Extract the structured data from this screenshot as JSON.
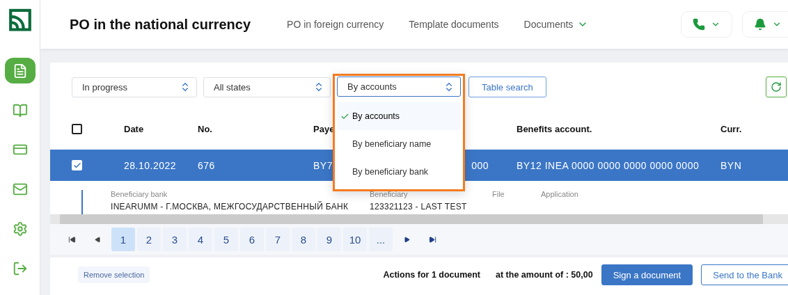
{
  "header": {
    "title": "PO in the national currency",
    "nav": [
      {
        "label": "PO in foreign currency",
        "dropdown": false
      },
      {
        "label": "Template documents",
        "dropdown": false
      },
      {
        "label": "Documents",
        "dropdown": true
      }
    ]
  },
  "sidebar": {
    "items": [
      {
        "selected": true
      },
      {
        "selected": false
      },
      {
        "selected": false
      },
      {
        "selected": false
      },
      {
        "selected": false
      },
      {
        "selected": false
      }
    ]
  },
  "filters": [
    {
      "value": "In progress"
    },
    {
      "value": "All states"
    }
  ],
  "grouping": {
    "value": "By accounts",
    "options": [
      {
        "label": "By accounts",
        "selected": true
      },
      {
        "label": "By beneficiary name",
        "selected": false
      },
      {
        "label": "By beneficiary bank",
        "selected": false
      }
    ]
  },
  "table_search": "Table search",
  "table": {
    "columns": [
      "Date",
      "No.",
      "Paye",
      "Benefits account.",
      "Curr."
    ],
    "select_all": false,
    "rows": [
      {
        "selected": true,
        "date": "28.10.2022",
        "number": "676",
        "payer_start": "BY7",
        "payer_end": "000",
        "benefits_account": "BY12 INEA 0000 0000 0000 0000 0000",
        "currency": "BYN"
      }
    ],
    "details": [
      {
        "label": "Beneficiary bank",
        "value": "INEARUMM - Г.МОСКВА, МЕЖГОСУДАРСТВЕННЫЙ БАНК"
      },
      {
        "label": "Beneficiary",
        "value": "123321123 - LAST TEST"
      },
      {
        "label": "File"
      },
      {
        "label": "Application"
      }
    ]
  },
  "pagination": {
    "pages": [
      {
        "label": "1",
        "selected": true
      },
      {
        "label": "2",
        "selected": false
      },
      {
        "label": "3",
        "selected": false
      },
      {
        "label": "4",
        "selected": false
      },
      {
        "label": "5",
        "selected": false
      },
      {
        "label": "6",
        "selected": false
      },
      {
        "label": "7",
        "selected": false
      },
      {
        "label": "8",
        "selected": false
      },
      {
        "label": "9",
        "selected": false
      },
      {
        "label": "10",
        "selected": false
      },
      {
        "label": "...",
        "selected": false
      }
    ]
  },
  "footer": {
    "remove_selection": "Remove selection",
    "actions": "Actions for 1 document",
    "amount": "at the amount of : 50,00",
    "buttons": [
      {
        "label": "Sign a document",
        "kind": "primary"
      },
      {
        "label": "Send to the Bank",
        "kind": "outline"
      }
    ]
  }
}
